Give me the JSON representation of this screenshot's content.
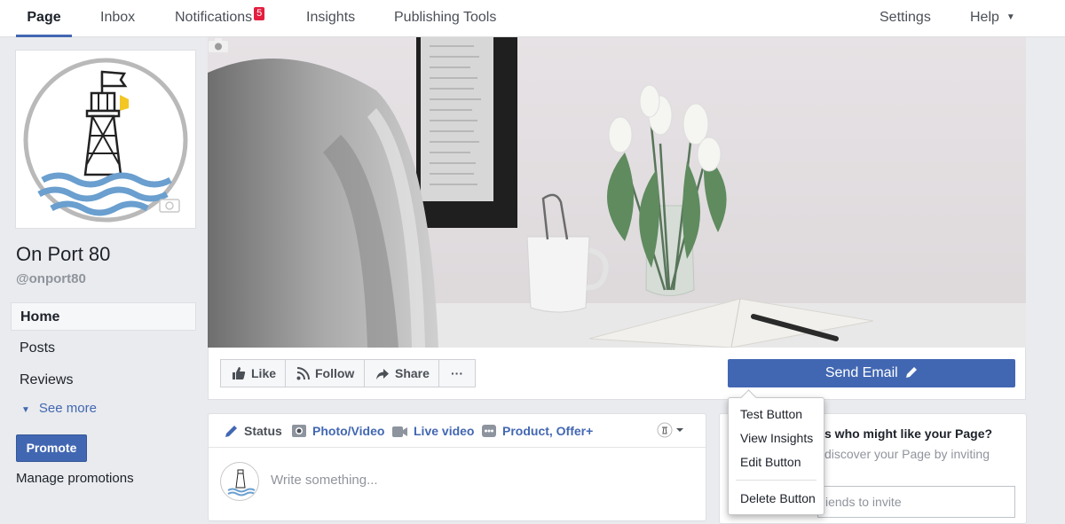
{
  "topnav": {
    "tabs": [
      {
        "label": "Page"
      },
      {
        "label": "Inbox"
      },
      {
        "label": "Notifications",
        "badge": "5"
      },
      {
        "label": "Insights"
      },
      {
        "label": "Publishing Tools"
      }
    ],
    "settings_label": "Settings",
    "help_label": "Help"
  },
  "sidebar": {
    "page_name": "On Port 80",
    "handle": "@onport80",
    "items": [
      {
        "label": "Home"
      },
      {
        "label": "Posts"
      },
      {
        "label": "Reviews"
      }
    ],
    "see_more_label": "See more",
    "promote_label": "Promote",
    "manage_promotions_label": "Manage promotions"
  },
  "action_bar": {
    "like_label": "Like",
    "follow_label": "Follow",
    "share_label": "Share",
    "more_label": "···",
    "send_email_label": "Send Email"
  },
  "composer": {
    "tabs": [
      {
        "label": "Status"
      },
      {
        "label": "Photo/Video"
      },
      {
        "label": "Live video"
      },
      {
        "label": "Product, Offer+"
      }
    ],
    "placeholder": "Write something..."
  },
  "invite_card": {
    "title_visible": "s who might like your Page?",
    "desc_visible": "discover your Page by inviting",
    "input_visible": "iends to invite"
  },
  "dropdown": {
    "items": [
      {
        "label": "Test Button"
      },
      {
        "label": "View Insights"
      },
      {
        "label": "Edit Button"
      },
      {
        "label": "Delete Button"
      }
    ]
  },
  "colors": {
    "brand_blue": "#4267b2",
    "badge_red": "#e41e3f",
    "page_bg": "#e9ebee"
  },
  "icons": [
    "camera-icon",
    "thumbs-up-icon",
    "rss-icon",
    "share-arrow-icon",
    "pencil-icon",
    "photo-icon",
    "video-camera-icon",
    "product-icon",
    "chevron-down-icon",
    "lighthouse-logo"
  ]
}
